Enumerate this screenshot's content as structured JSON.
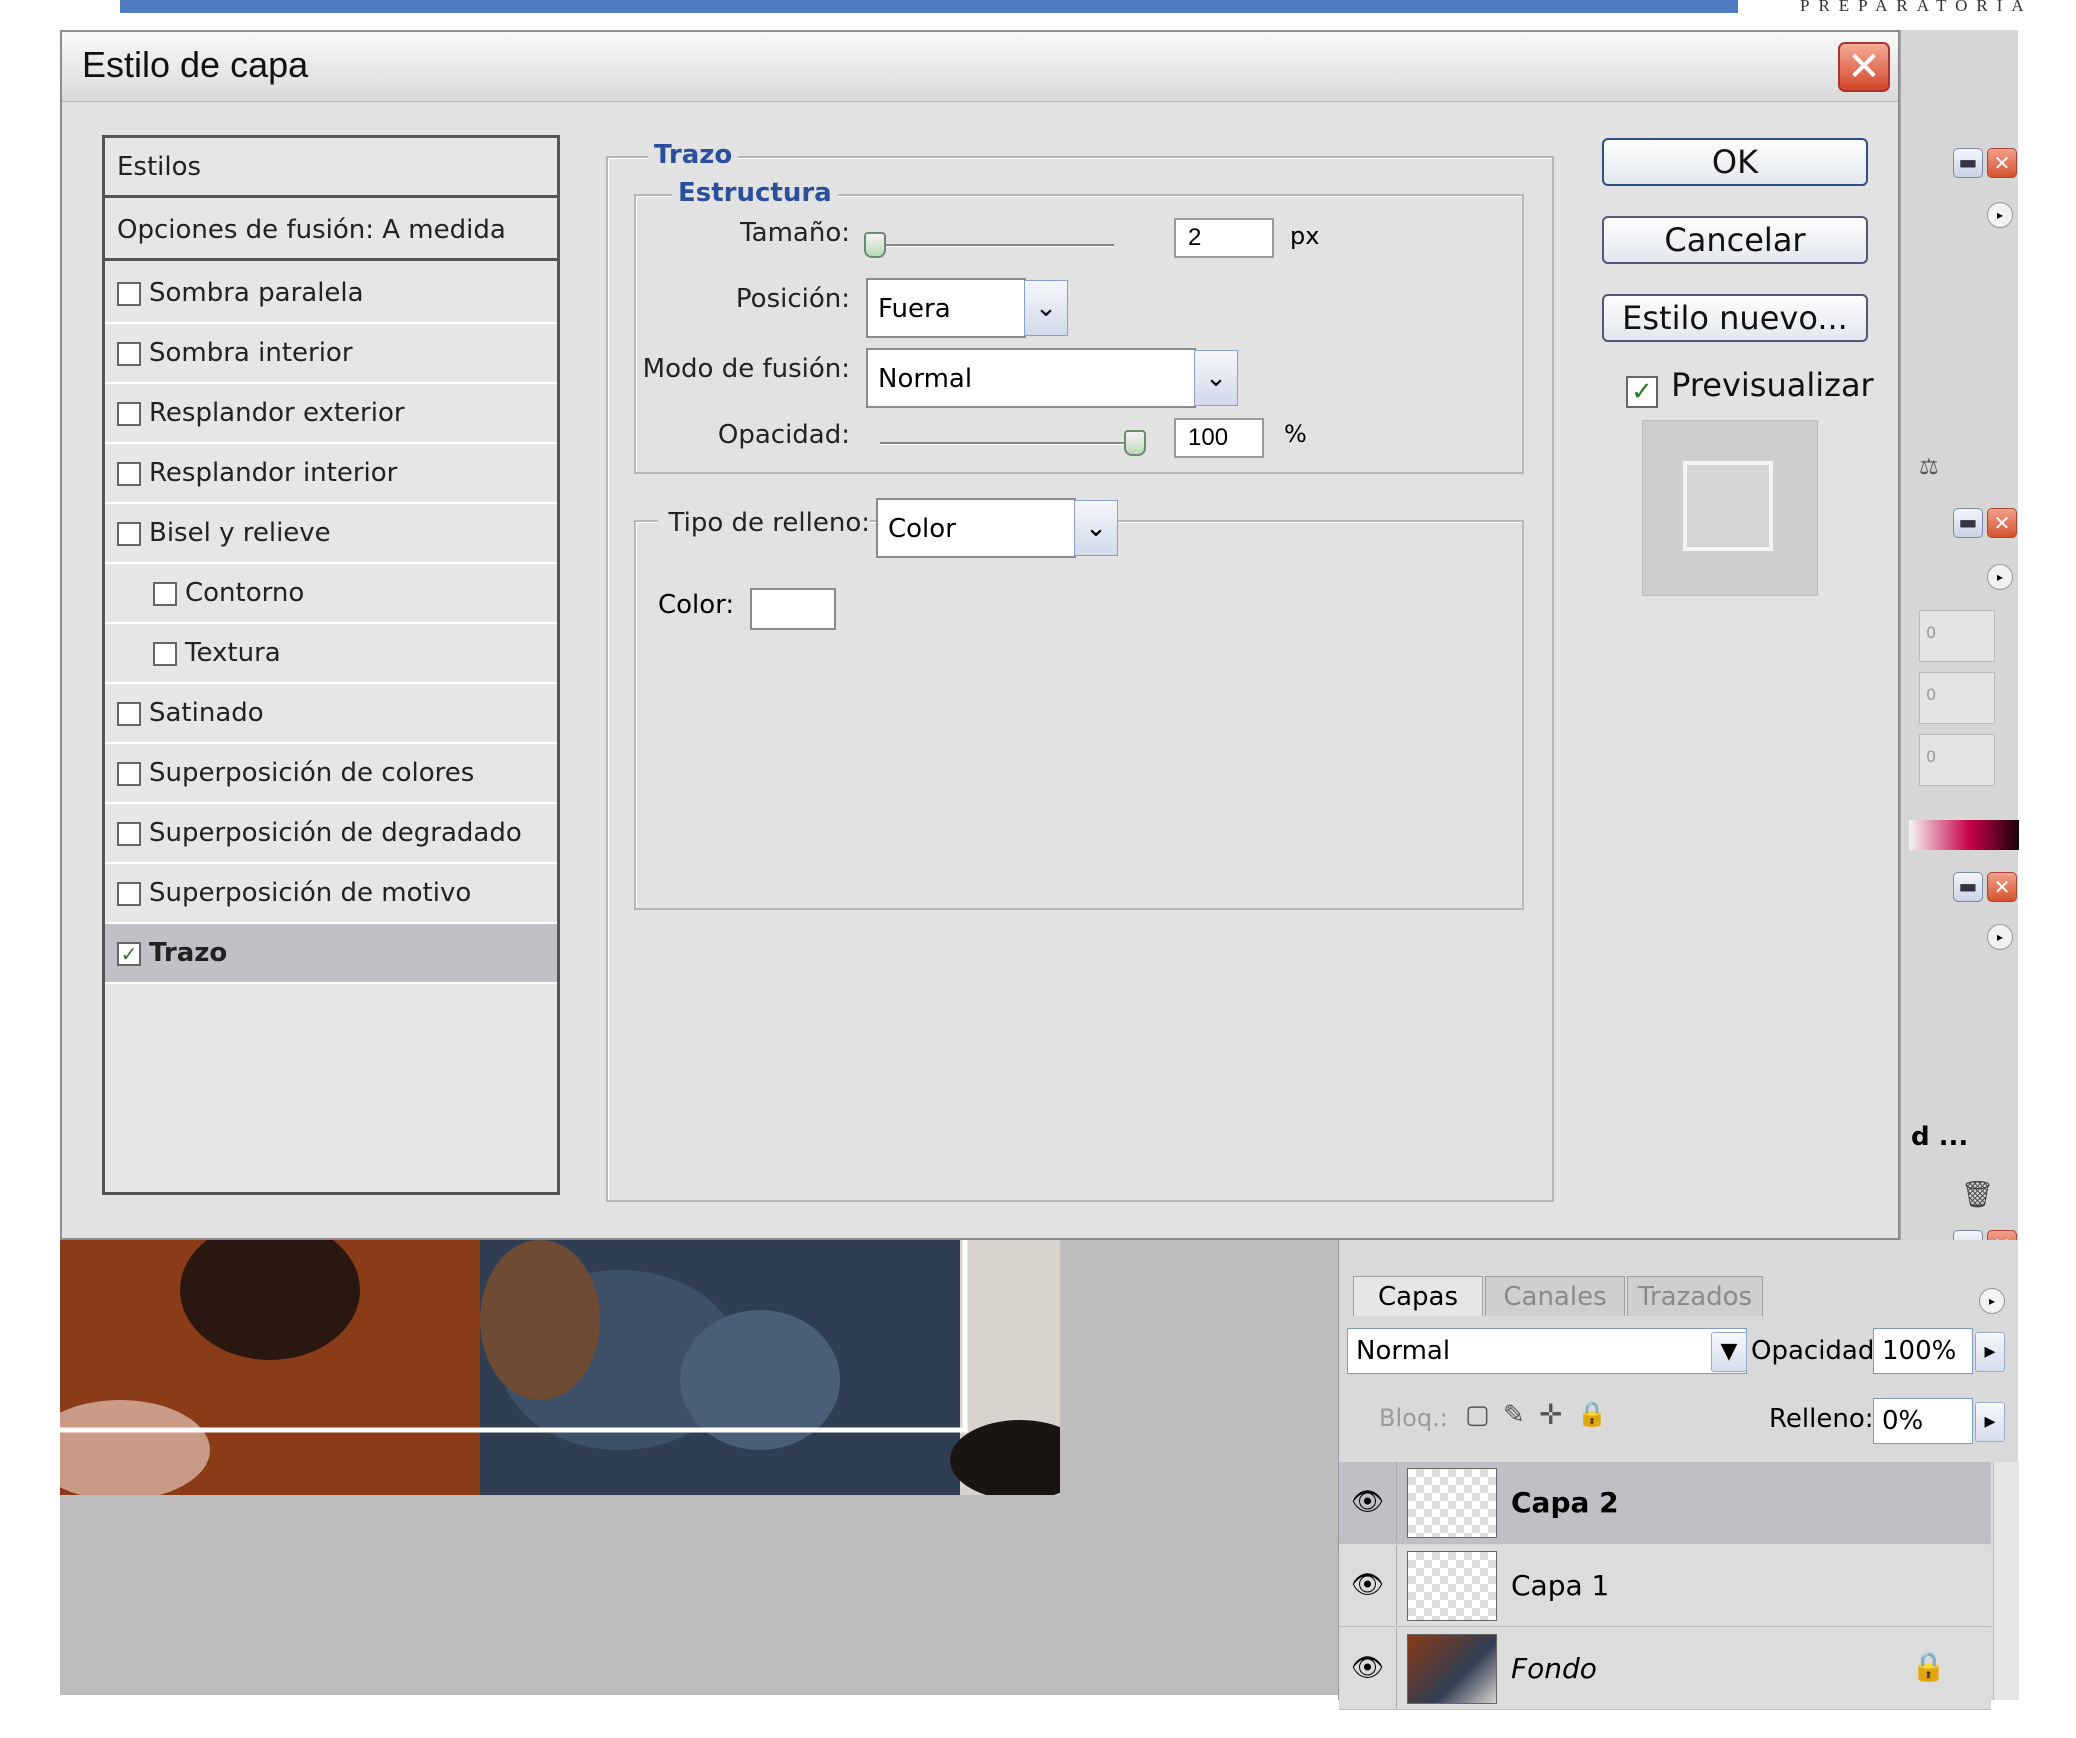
{
  "brand": "PREPARATORIA",
  "dialog": {
    "title": "Estilo de capa",
    "styles_panel": {
      "header": "Estilos",
      "blending_options": "Opciones de fusión: A medida",
      "items": [
        {
          "label": "Sombra paralela",
          "checked": false,
          "indent": false
        },
        {
          "label": "Sombra interior",
          "checked": false,
          "indent": false
        },
        {
          "label": "Resplandor exterior",
          "checked": false,
          "indent": false
        },
        {
          "label": "Resplandor interior",
          "checked": false,
          "indent": false
        },
        {
          "label": "Bisel y relieve",
          "checked": false,
          "indent": false
        },
        {
          "label": "Contorno",
          "checked": false,
          "indent": true
        },
        {
          "label": "Textura",
          "checked": false,
          "indent": true
        },
        {
          "label": "Satinado",
          "checked": false,
          "indent": false
        },
        {
          "label": "Superposición de colores",
          "checked": false,
          "indent": false
        },
        {
          "label": "Superposición de degradado",
          "checked": false,
          "indent": false
        },
        {
          "label": "Superposición de motivo",
          "checked": false,
          "indent": false
        },
        {
          "label": "Trazo",
          "checked": true,
          "indent": false,
          "selected": true
        }
      ]
    },
    "stroke": {
      "group_title": "Trazo",
      "structure_title": "Estructura",
      "size_label": "Tamaño:",
      "size_value": "2",
      "size_unit": "px",
      "size_fraction": 0.0,
      "position_label": "Posición:",
      "position_value": "Fuera",
      "blend_label": "Modo de fusión:",
      "blend_value": "Normal",
      "opacity_label": "Opacidad:",
      "opacity_value": "100",
      "opacity_unit": "%",
      "opacity_fraction": 1.0,
      "fill_type_label": "Tipo de relleno:",
      "fill_type_value": "Color",
      "color_label": "Color:",
      "color_value": "#ffffff"
    },
    "buttons": {
      "ok": "OK",
      "cancel": "Cancelar",
      "new_style": "Estilo nuevo...",
      "preview_label": "Previsualizar",
      "preview_checked": true
    }
  },
  "side_panel": {
    "truncated_label": "d ...",
    "field_values": [
      "0",
      "0",
      "0"
    ]
  },
  "layers_panel": {
    "tabs": [
      "Capas",
      "Canales",
      "Trazados"
    ],
    "blend_mode": "Normal",
    "opacity_label": "Opacidad:",
    "opacity_value": "100%",
    "lock_label": "Bloq.:",
    "fill_label": "Relleno:",
    "fill_value": "0%",
    "layers": [
      {
        "name": "Capa 2",
        "selected": true,
        "visible": true
      },
      {
        "name": "Capa 1",
        "selected": false,
        "visible": true
      },
      {
        "name": "Fondo",
        "selected": false,
        "visible": true,
        "locked": true
      }
    ]
  },
  "colors": {
    "accent_blue": "#2b4f9a",
    "top_bar": "#4f7cc0",
    "close_red": "#d2462a"
  }
}
